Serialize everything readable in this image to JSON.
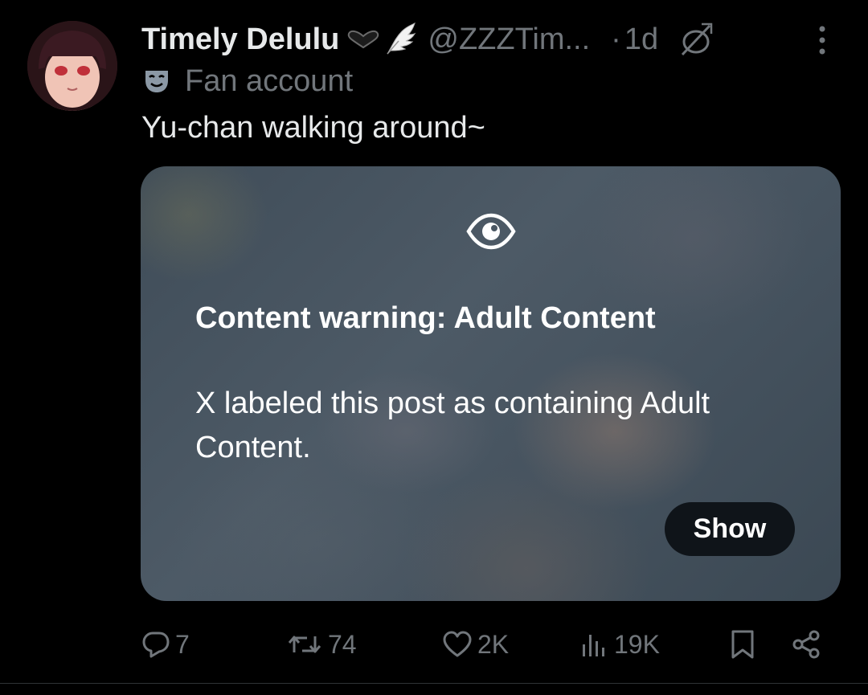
{
  "tweet": {
    "author_name": "Timely Delulu",
    "handle": "@ZZZTim...",
    "separator": "·",
    "time": "1d",
    "account_label": "Fan account",
    "text": "Yu-chan walking around~"
  },
  "media": {
    "warning_title": "Content warning: Adult Content",
    "warning_body": "X labeled this post as containing Adult Content.",
    "show_label": "Show"
  },
  "actions": {
    "replies": "7",
    "reposts": "74",
    "likes": "2K",
    "views": "19K"
  },
  "colors": {
    "background": "#000000",
    "primary_text": "#e7e9ea",
    "secondary_text": "#71767b",
    "button_bg": "#0f1419"
  },
  "icons": [
    "heart-icon",
    "wing-icon",
    "null-icon",
    "more-icon",
    "mask-icon",
    "eye-icon",
    "reply-icon",
    "repost-icon",
    "like-icon",
    "views-icon",
    "bookmark-icon",
    "share-icon"
  ]
}
